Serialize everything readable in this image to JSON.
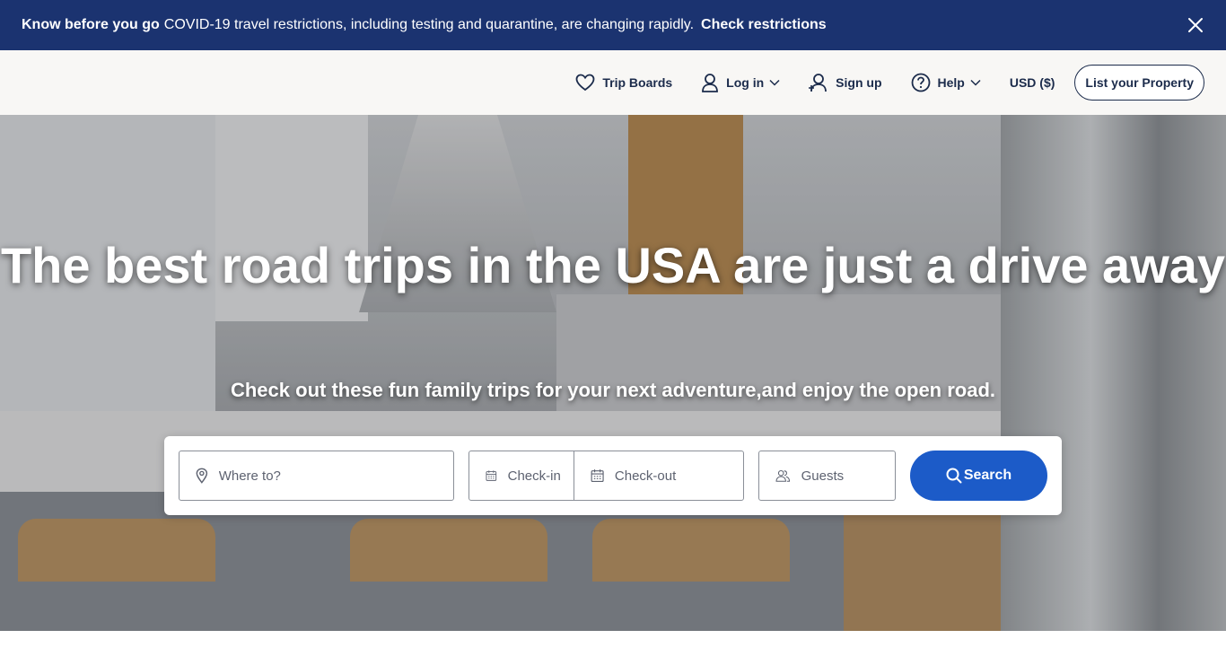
{
  "banner": {
    "title": "Know before you go",
    "message": "COVID-19 travel restrictions, including testing and quarantine, are changing rapidly.",
    "link": "Check restrictions",
    "close_icon": "close-icon"
  },
  "header": {
    "nav": {
      "trip_boards": "Trip Boards",
      "login": "Log in",
      "signup": "Sign up",
      "help": "Help",
      "currency": "USD ($)",
      "list_property": "List your Property"
    }
  },
  "hero": {
    "title": "The best road trips in the USA are just a drive away",
    "subtitle": "Check out these fun family trips for your next adventure,and enjoy the open road."
  },
  "search": {
    "where_placeholder": "Where to?",
    "checkin_placeholder": "Check-in",
    "checkout_placeholder": "Check-out",
    "guests_placeholder": "Guests",
    "button": "Search"
  },
  "colors": {
    "banner_bg": "#1b3370",
    "accent": "#1c5bc8",
    "text_dark": "#1b2b4b"
  }
}
